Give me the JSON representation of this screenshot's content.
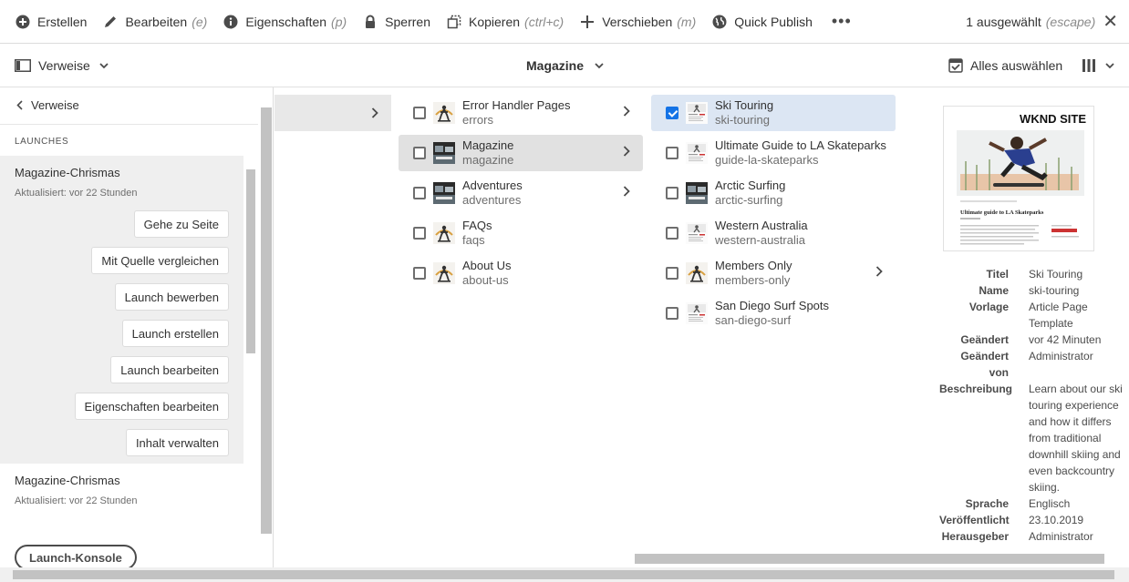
{
  "actionbar": {
    "items": [
      {
        "label": "Erstellen",
        "shortcut": "",
        "icon": "add-circle-icon"
      },
      {
        "label": "Bearbeiten",
        "shortcut": "(e)",
        "icon": "pencil-icon"
      },
      {
        "label": "Eigenschaften",
        "shortcut": "(p)",
        "icon": "info-icon"
      },
      {
        "label": "Sperren",
        "shortcut": "",
        "icon": "lock-icon"
      },
      {
        "label": "Kopieren",
        "shortcut": "(ctrl+c)",
        "icon": "copy-icon"
      },
      {
        "label": "Verschieben",
        "shortcut": "(m)",
        "icon": "move-icon"
      },
      {
        "label": "Quick Publish",
        "shortcut": "",
        "icon": "globe-icon"
      }
    ],
    "more": "•••",
    "selection": {
      "label": "1 ausgewählt",
      "shortcut": "(escape)",
      "close": "✕"
    }
  },
  "subbar": {
    "rail_toggle": "Verweise",
    "title": "Magazine",
    "select_all": "Alles auswählen"
  },
  "rail": {
    "back": "Verweise",
    "heading": "LAUNCHES",
    "launches": [
      {
        "name": "Magazine-Chrismas",
        "meta": "Aktualisiert: vor 22 Stunden"
      },
      {
        "name": "Magazine-Chrismas",
        "meta": "Aktualisiert: vor 22 Stunden"
      }
    ],
    "buttons": [
      "Gehe zu Seite",
      "Mit Quelle vergleichen",
      "Launch bewerben",
      "Launch erstellen",
      "Launch bearbeiten",
      "Eigenschaften bearbeiten",
      "Inhalt verwalten"
    ],
    "console": "Launch-Konsole"
  },
  "columns": {
    "col1": [
      {
        "title": "Error Handler Pages",
        "name": "errors",
        "children": true,
        "state": "none",
        "thumb": "skater"
      },
      {
        "title": "Magazine",
        "name": "magazine",
        "children": true,
        "state": "active",
        "thumb": "surf"
      },
      {
        "title": "Adventures",
        "name": "adventures",
        "children": true,
        "state": "none",
        "thumb": "surf"
      },
      {
        "title": "FAQs",
        "name": "faqs",
        "children": false,
        "state": "none",
        "thumb": "skater"
      },
      {
        "title": "About Us",
        "name": "about-us",
        "children": false,
        "state": "none",
        "thumb": "skater"
      }
    ],
    "col2": [
      {
        "title": "Ski Touring",
        "name": "ski-touring",
        "children": false,
        "state": "checked",
        "thumb": "doc"
      },
      {
        "title": "Ultimate Guide to LA Skateparks",
        "name": "guide-la-skateparks",
        "children": false,
        "state": "none",
        "thumb": "doc"
      },
      {
        "title": "Arctic Surfing",
        "name": "arctic-surfing",
        "children": false,
        "state": "none",
        "thumb": "surf"
      },
      {
        "title": "Western Australia",
        "name": "western-australia",
        "children": false,
        "state": "none",
        "thumb": "doc"
      },
      {
        "title": "Members Only",
        "name": "members-only",
        "children": true,
        "state": "none",
        "thumb": "skater"
      },
      {
        "title": "San Diego Surf Spots",
        "name": "san-diego-surf",
        "children": false,
        "state": "none",
        "thumb": "doc"
      }
    ]
  },
  "preview": {
    "brand": "WKND SITE",
    "article_title": "Ultimate guide to LA Skateparks"
  },
  "properties": [
    {
      "key": "Titel",
      "value": "Ski Touring"
    },
    {
      "key": "Name",
      "value": "ski-touring"
    },
    {
      "key": "Vorlage",
      "value": "Article Page Template"
    },
    {
      "key": "Geändert",
      "value": "vor 42 Minuten"
    },
    {
      "key": "Geändert von",
      "value": "Administrator"
    },
    {
      "key": "Beschreibung",
      "value": "Learn about our ski touring experience and how it differs from traditional downhill skiing and even backcountry skiing."
    },
    {
      "key": "Sprache",
      "value": "Englisch"
    },
    {
      "key": "Veröffentlicht",
      "value": "23.10.2019"
    },
    {
      "key": "Herausgeber",
      "value": "Administrator"
    }
  ],
  "colors": {
    "accent": "#1473e6",
    "selected_row": "#dce6f3",
    "active_row": "#e1e1e1",
    "rail_card": "#efefef"
  }
}
